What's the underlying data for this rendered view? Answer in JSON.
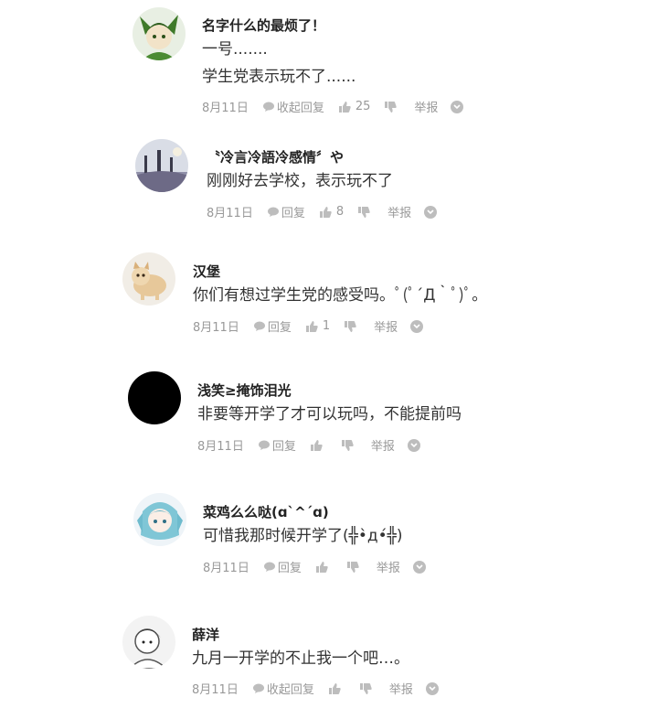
{
  "comments": [
    {
      "name": "名字什么的最烦了！",
      "lines": [
        "一号.......",
        "学生党表示玩不了......"
      ],
      "date": "8月11日",
      "reply_label": "收起回复",
      "likes": "25",
      "report_label": "举报"
    },
    {
      "name": "〝冷言冷語冷感情〞や",
      "lines": [
        "刚刚好去学校，表示玩不了"
      ],
      "date": "8月11日",
      "reply_label": "回复",
      "likes": "8",
      "report_label": "举报"
    },
    {
      "name": "汉堡",
      "lines": [
        "你们有想过学生党的感受吗。ﾟ(ﾟ´Д｀ﾟ)ﾟ。"
      ],
      "date": "8月11日",
      "reply_label": "回复",
      "likes": "1",
      "report_label": "举报"
    },
    {
      "name": "浅笑≥掩饰泪光",
      "lines": [
        "非要等开学了才可以玩吗，不能提前吗"
      ],
      "date": "8月11日",
      "reply_label": "回复",
      "likes": "",
      "report_label": "举报"
    },
    {
      "name": "菜鸡么么哒(ɑ`^´ɑ)",
      "lines": [
        "可惜我那时候开学了(╬•̀д•́╬)"
      ],
      "date": "8月11日",
      "reply_label": "回复",
      "likes": "",
      "report_label": "举报"
    },
    {
      "name": "薛洋",
      "lines": [
        "九月一开学的不止我一个吧…。"
      ],
      "date": "8月11日",
      "reply_label": "收起回复",
      "likes": "",
      "report_label": "举报"
    }
  ],
  "colors": {
    "meta_gray": "#999999",
    "icon_gray": "#bdbdbd"
  }
}
